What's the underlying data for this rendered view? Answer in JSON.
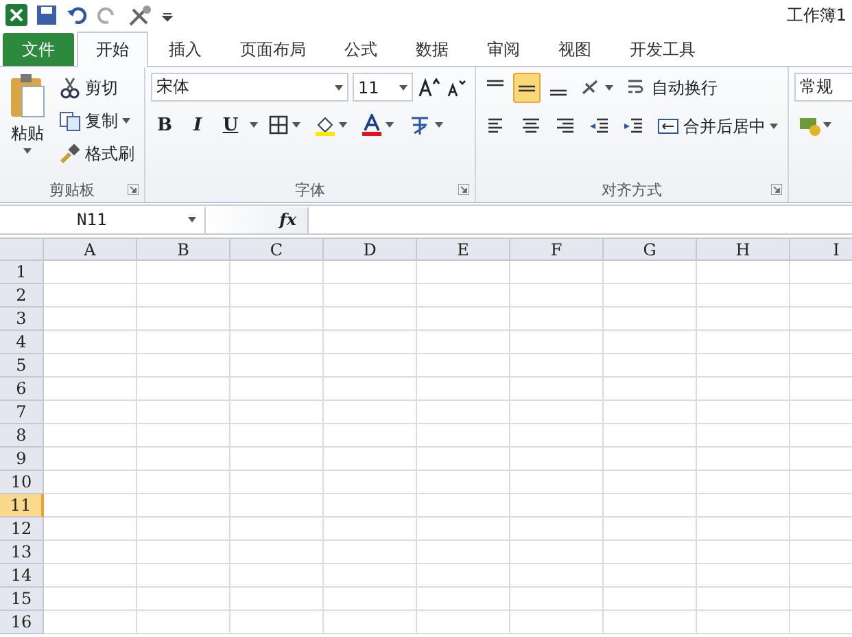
{
  "window": {
    "title": "工作簿1"
  },
  "tabs": [
    {
      "label": "文件",
      "kind": "file",
      "selected": false
    },
    {
      "label": "开始",
      "kind": "tab",
      "selected": true
    },
    {
      "label": "插入",
      "kind": "tab",
      "selected": false
    },
    {
      "label": "页面布局",
      "kind": "tab",
      "selected": false
    },
    {
      "label": "公式",
      "kind": "tab",
      "selected": false
    },
    {
      "label": "数据",
      "kind": "tab",
      "selected": false
    },
    {
      "label": "审阅",
      "kind": "tab",
      "selected": false
    },
    {
      "label": "视图",
      "kind": "tab",
      "selected": false
    },
    {
      "label": "开发工具",
      "kind": "tab",
      "selected": false
    }
  ],
  "clipboard": {
    "paste": "粘贴",
    "cut": "剪切",
    "copy": "复制",
    "format_painter": "格式刷",
    "group_label": "剪贴板"
  },
  "font": {
    "name": "宋体",
    "size": "11",
    "bold": "B",
    "italic": "I",
    "underline": "U",
    "group_label": "字体"
  },
  "alignment": {
    "vertical": [
      {
        "selected": false
      },
      {
        "selected": true
      },
      {
        "selected": false
      }
    ],
    "wrap": "自动换行",
    "merge": "合并后居中",
    "group_label": "对齐方式"
  },
  "number": {
    "format": "常规"
  },
  "formula_bar": {
    "name_box": "N11",
    "fx": "fx"
  },
  "sheet": {
    "columns": [
      "A",
      "B",
      "C",
      "D",
      "E",
      "F",
      "G",
      "H",
      "I"
    ],
    "rows": [
      {
        "label": "1",
        "selected": false
      },
      {
        "label": "2",
        "selected": false
      },
      {
        "label": "3",
        "selected": false
      },
      {
        "label": "4",
        "selected": false
      },
      {
        "label": "5",
        "selected": false
      },
      {
        "label": "6",
        "selected": false
      },
      {
        "label": "7",
        "selected": false
      },
      {
        "label": "8",
        "selected": false
      },
      {
        "label": "9",
        "selected": false
      },
      {
        "label": "10",
        "selected": false
      },
      {
        "label": "11",
        "selected": true
      },
      {
        "label": "12",
        "selected": false
      },
      {
        "label": "13",
        "selected": false
      },
      {
        "label": "14",
        "selected": false
      },
      {
        "label": "15",
        "selected": false
      },
      {
        "label": "16",
        "selected": false
      }
    ]
  }
}
